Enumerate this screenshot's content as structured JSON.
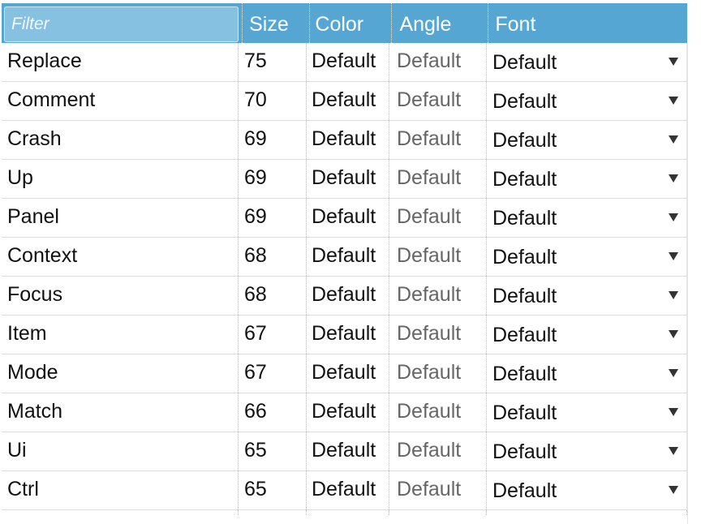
{
  "header": {
    "filter_placeholder": "Filter",
    "columns": [
      "Size",
      "Color",
      "Angle",
      "Font"
    ]
  },
  "rows": [
    {
      "name": "Replace",
      "size": "75",
      "color": "Default",
      "angle": "Default",
      "font": "Default"
    },
    {
      "name": "Comment",
      "size": "70",
      "color": "Default",
      "angle": "Default",
      "font": "Default"
    },
    {
      "name": "Crash",
      "size": "69",
      "color": "Default",
      "angle": "Default",
      "font": "Default"
    },
    {
      "name": "Up",
      "size": "69",
      "color": "Default",
      "angle": "Default",
      "font": "Default"
    },
    {
      "name": "Panel",
      "size": "69",
      "color": "Default",
      "angle": "Default",
      "font": "Default"
    },
    {
      "name": "Context",
      "size": "68",
      "color": "Default",
      "angle": "Default",
      "font": "Default"
    },
    {
      "name": "Focus",
      "size": "68",
      "color": "Default",
      "angle": "Default",
      "font": "Default"
    },
    {
      "name": "Item",
      "size": "67",
      "color": "Default",
      "angle": "Default",
      "font": "Default"
    },
    {
      "name": "Mode",
      "size": "67",
      "color": "Default",
      "angle": "Default",
      "font": "Default"
    },
    {
      "name": "Match",
      "size": "66",
      "color": "Default",
      "angle": "Default",
      "font": "Default"
    },
    {
      "name": "Ui",
      "size": "65",
      "color": "Default",
      "angle": "Default",
      "font": "Default"
    },
    {
      "name": "Ctrl",
      "size": "65",
      "color": "Default",
      "angle": "Default",
      "font": "Default"
    }
  ],
  "colors": {
    "header_bg": "#56a6d3",
    "filter_bg": "#86c1e2",
    "text": "#111111",
    "muted_text": "#666666"
  },
  "icons": {
    "dropdown": "chevron-down-icon"
  }
}
